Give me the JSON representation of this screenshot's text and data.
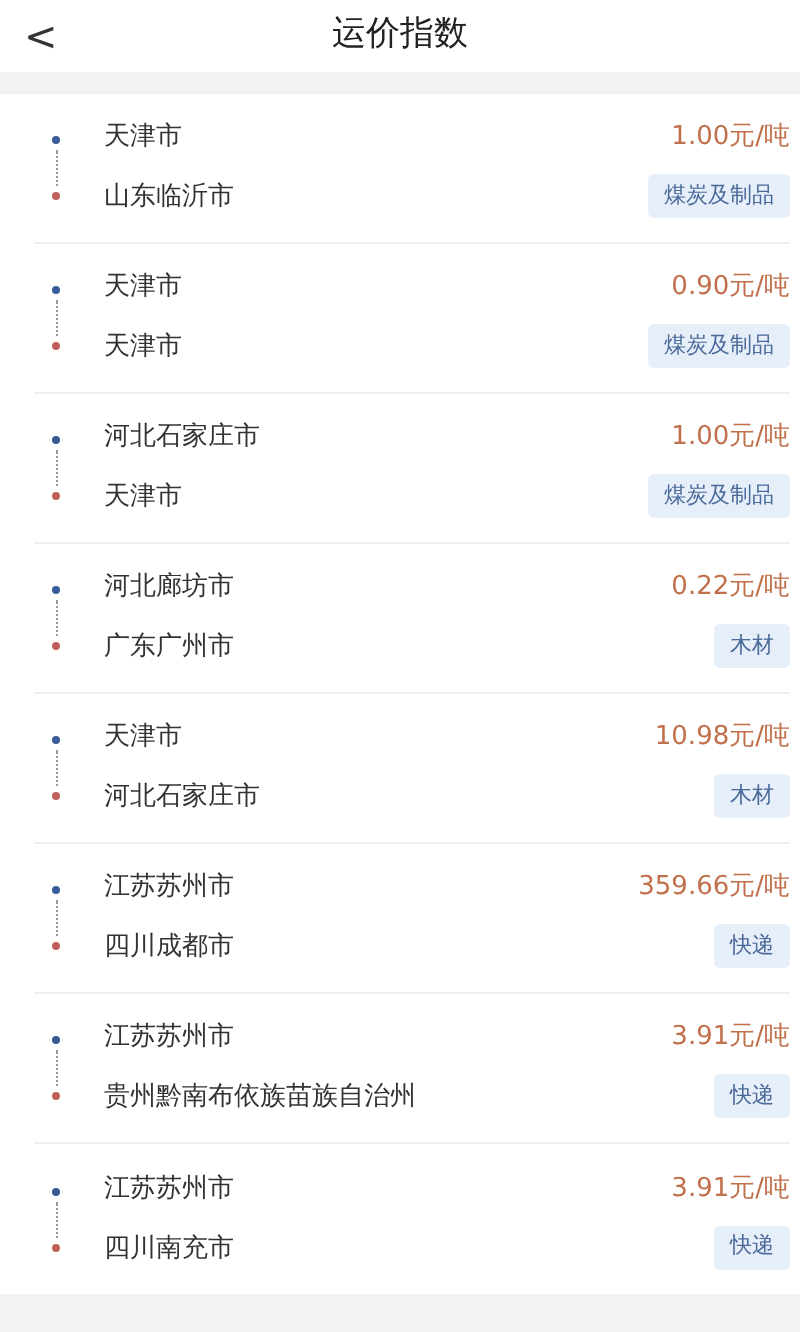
{
  "header": {
    "back": "<",
    "title": "运价指数"
  },
  "routes": [
    {
      "from": "天津市",
      "to": "山东临沂市",
      "price": "1.00元/吨",
      "category": "煤炭及制品"
    },
    {
      "from": "天津市",
      "to": "天津市",
      "price": "0.90元/吨",
      "category": "煤炭及制品"
    },
    {
      "from": "河北石家庄市",
      "to": "天津市",
      "price": "1.00元/吨",
      "category": "煤炭及制品"
    },
    {
      "from": "河北廊坊市",
      "to": "广东广州市",
      "price": "0.22元/吨",
      "category": "木材"
    },
    {
      "from": "天津市",
      "to": "河北石家庄市",
      "price": "10.98元/吨",
      "category": "木材"
    },
    {
      "from": "江苏苏州市",
      "to": "四川成都市",
      "price": "359.66元/吨",
      "category": "快递"
    },
    {
      "from": "江苏苏州市",
      "to": "贵州黔南布依族苗族自治州",
      "price": "3.91元/吨",
      "category": "快递"
    },
    {
      "from": "江苏苏州市",
      "to": "四川南充市",
      "price": "3.91元/吨",
      "category": "快递"
    }
  ]
}
